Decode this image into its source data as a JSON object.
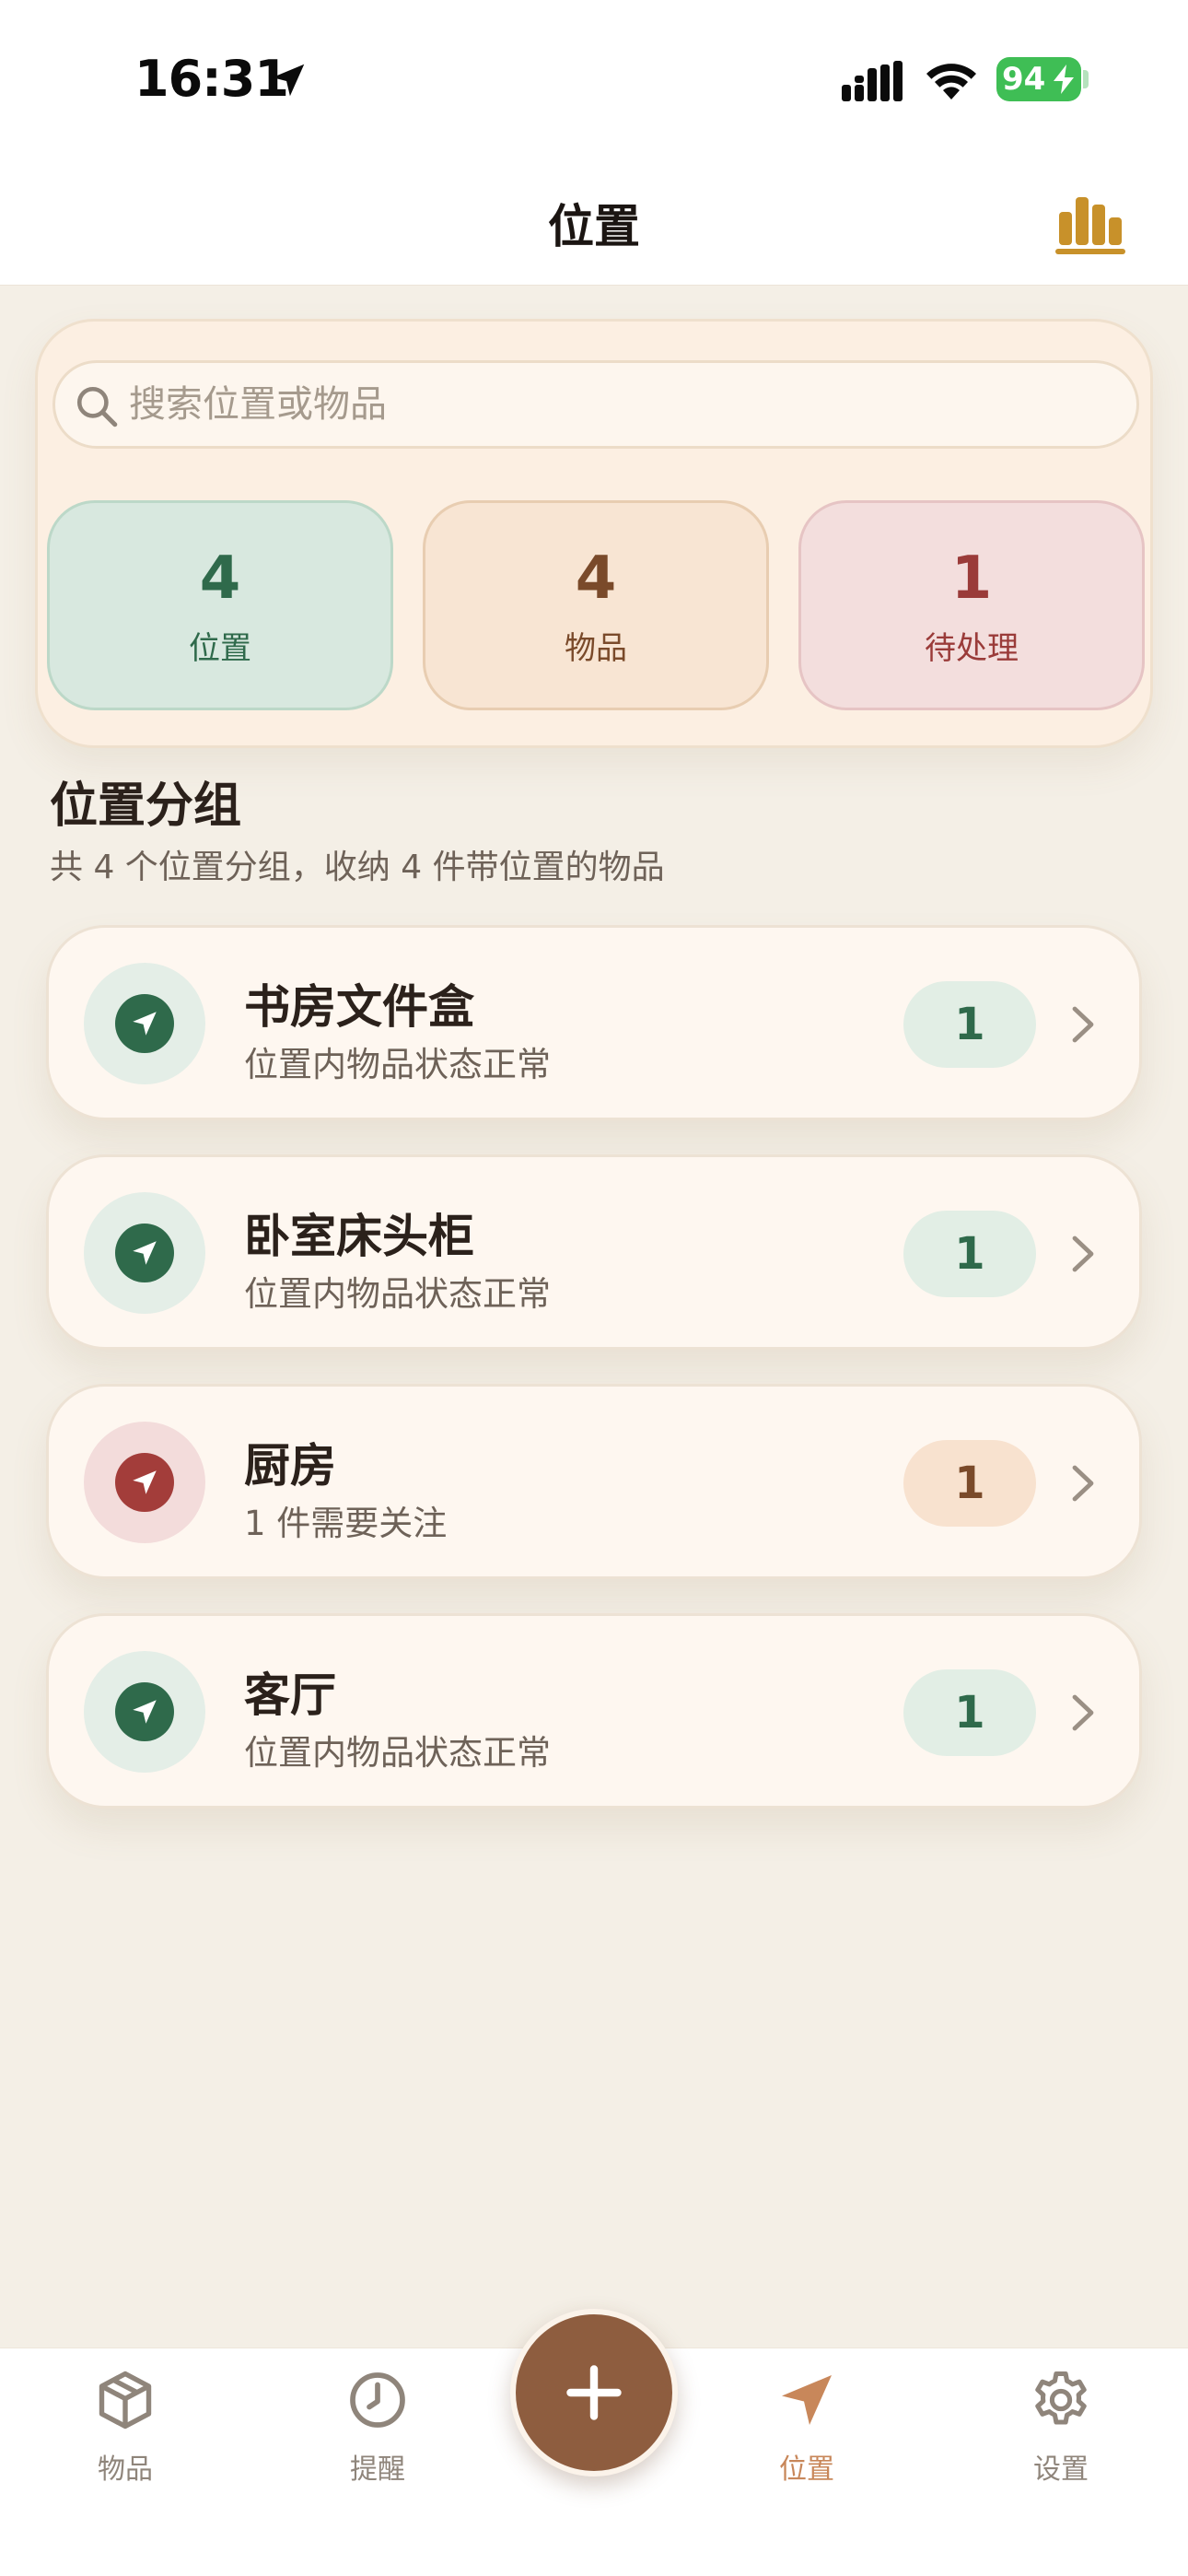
{
  "status_bar": {
    "time": "16:31",
    "battery": "94"
  },
  "nav": {
    "title": "位置",
    "chart_icon": "bar-chart-icon"
  },
  "search": {
    "placeholder": "搜索位置或物品"
  },
  "stats": [
    {
      "value": "4",
      "label": "位置",
      "color": "#2f6a4b"
    },
    {
      "value": "4",
      "label": "物品",
      "color": "#7a4a2a"
    },
    {
      "value": "1",
      "label": "待处理",
      "color": "#9a3b39"
    }
  ],
  "section": {
    "title": "位置分组",
    "subtitle": "共 4 个位置分组，收纳 4 件带位置的物品"
  },
  "locations": [
    {
      "name": "书房文件盒",
      "status": "位置内物品状态正常",
      "count": "1",
      "state": "ok"
    },
    {
      "name": "卧室床头柜",
      "status": "位置内物品状态正常",
      "count": "1",
      "state": "ok"
    },
    {
      "name": "厨房",
      "status": "1 件需要关注",
      "count": "1",
      "state": "warn"
    },
    {
      "name": "客厅",
      "status": "位置内物品状态正常",
      "count": "1",
      "state": "ok"
    }
  ],
  "tabs": [
    {
      "label": "物品",
      "icon": "box-icon"
    },
    {
      "label": "提醒",
      "icon": "clock-icon"
    },
    {
      "label": "位置",
      "icon": "location-arrow-icon",
      "active": true
    },
    {
      "label": "设置",
      "icon": "gear-icon"
    }
  ],
  "colors": {
    "accent": "#8e5d3f",
    "active_tab": "#c8875a",
    "ok": "#2f6a4b",
    "warn": "#a33d3a"
  }
}
